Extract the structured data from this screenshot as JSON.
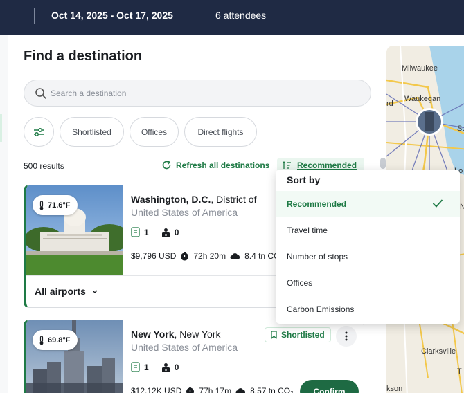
{
  "header": {
    "dates": "Oct 14, 2025 - Oct 17, 2025",
    "attendees": "6 attendees"
  },
  "page_title": "Find a destination",
  "search": {
    "placeholder": "Search a destination",
    "value": ""
  },
  "filters": {
    "chips": [
      "Shortlisted",
      "Offices",
      "Direct flights"
    ]
  },
  "results_count": "500 results",
  "refresh_label": "Refresh all destinations",
  "sort": {
    "current": "Recommended",
    "menu_title": "Sort by",
    "options": [
      "Recommended",
      "Travel time",
      "Number of stops",
      "Offices",
      "Carbon Emissions"
    ],
    "selected_index": 0
  },
  "cards": [
    {
      "temp": "71.6°F",
      "city": "Washington, D.C.",
      "region": ", District of",
      "country": "United States of America",
      "offices": "1",
      "stops": "0",
      "price": "$9,796 USD",
      "duration": "72h 20m",
      "co2": "8.4 tn CO",
      "airports_label": "All airports"
    },
    {
      "temp": "69.8°F",
      "city": "New York",
      "region": ", New York",
      "country": "United States of America",
      "shortlisted": "Shortlisted",
      "offices": "1",
      "stops": "0",
      "price": "$12.12K USD",
      "duration": "77h 17m",
      "co2": "8.57 tn CO₂",
      "confirm": "Confirm"
    }
  ],
  "map_labels": [
    "Milwaukee",
    "Waukegan",
    "rd",
    "So",
    "Clarksville",
    "kson",
    "Lo",
    "N",
    "T"
  ],
  "colors": {
    "header_bg": "#1f2a44",
    "brand_green": "#1e7a45",
    "card_accent": "#1e7a45"
  }
}
